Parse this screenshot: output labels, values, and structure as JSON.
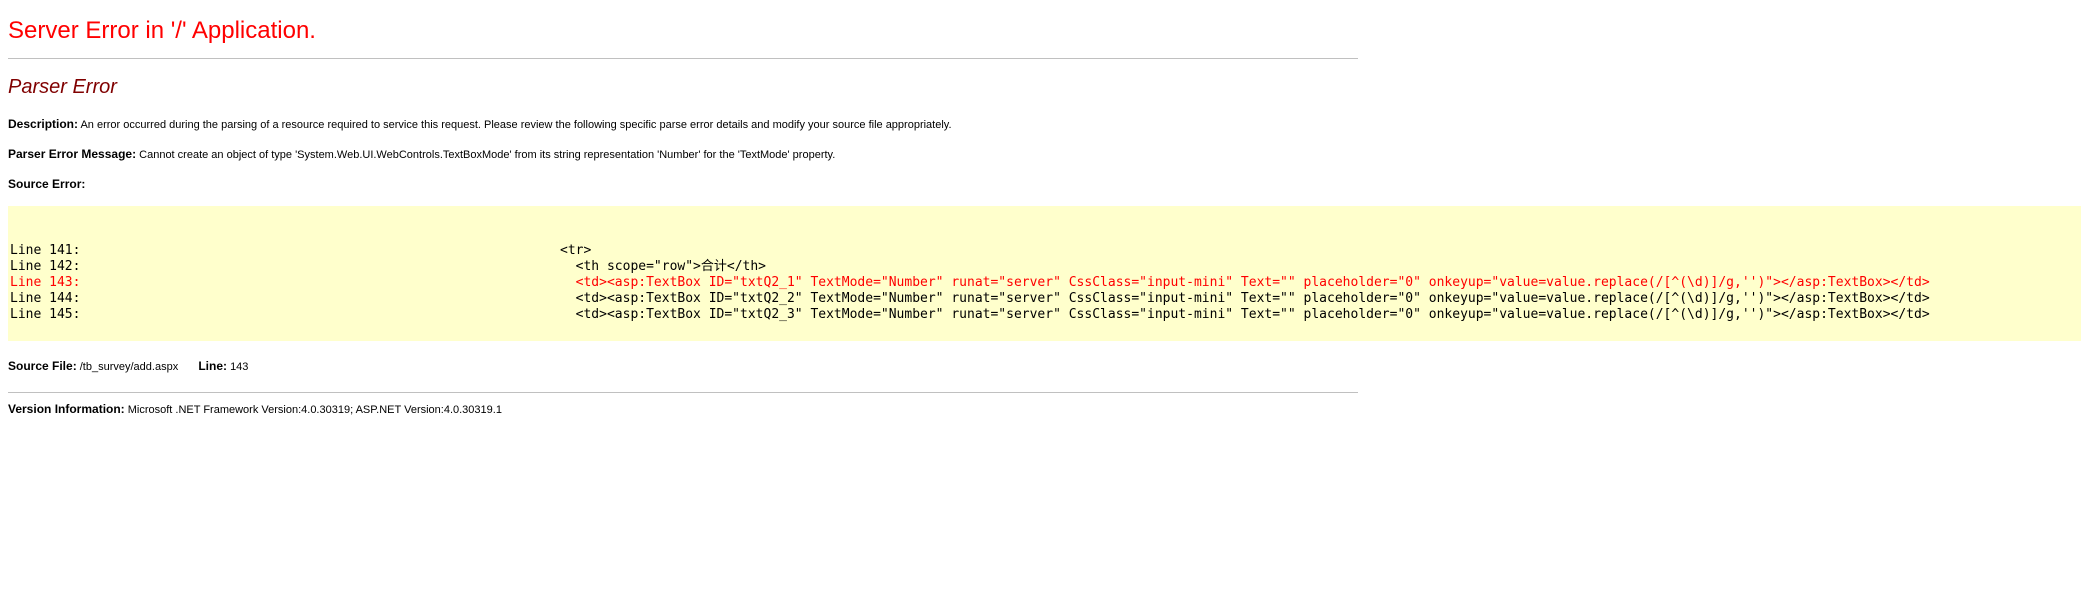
{
  "title": "Server Error in '/' Application.",
  "subtitle": "Parser Error",
  "description": {
    "label": "Description:",
    "text": "An error occurred during the parsing of a resource required to service this request. Please review the following specific parse error details and modify your source file appropriately."
  },
  "parser_error_message": {
    "label": "Parser Error Message:",
    "text": "Cannot create an object of type 'System.Web.UI.WebControls.TextBoxMode' from its string representation 'Number' for the 'TextMode' property."
  },
  "source_error": {
    "label": "Source Error:",
    "lines": [
      {
        "num": "Line 141:",
        "code": "<tr>",
        "error": false
      },
      {
        "num": "Line 142:",
        "code": "  <th scope=\"row\">合计</th>",
        "error": false
      },
      {
        "num": "Line 143:",
        "code": "  <td><asp:TextBox ID=\"txtQ2_1\" TextMode=\"Number\" runat=\"server\" CssClass=\"input-mini\" Text=\"\" placeholder=\"0\" onkeyup=\"value=value.replace(/[^(\\d)]/g,'')\"></asp:TextBox></td>",
        "error": true
      },
      {
        "num": "Line 144:",
        "code": "  <td><asp:TextBox ID=\"txtQ2_2\" TextMode=\"Number\" runat=\"server\" CssClass=\"input-mini\" Text=\"\" placeholder=\"0\" onkeyup=\"value=value.replace(/[^(\\d)]/g,'')\"></asp:TextBox></td>",
        "error": false
      },
      {
        "num": "Line 145:",
        "code": "  <td><asp:TextBox ID=\"txtQ2_3\" TextMode=\"Number\" runat=\"server\" CssClass=\"input-mini\" Text=\"\" placeholder=\"0\" onkeyup=\"value=value.replace(/[^(\\d)]/g,'')\"></asp:TextBox></td>",
        "error": false
      }
    ]
  },
  "source_file": {
    "label": "Source File:",
    "value": "/tb_survey/add.aspx",
    "line_label": "Line:",
    "line_value": "143"
  },
  "version_information": {
    "label": "Version Information:",
    "text": "Microsoft .NET Framework Version:4.0.30319; ASP.NET Version:4.0.30319.1"
  },
  "colors": {
    "title": "#ff0000",
    "subtitle": "#800000",
    "code_background": "#ffffcc",
    "error_line": "#ff0000"
  }
}
